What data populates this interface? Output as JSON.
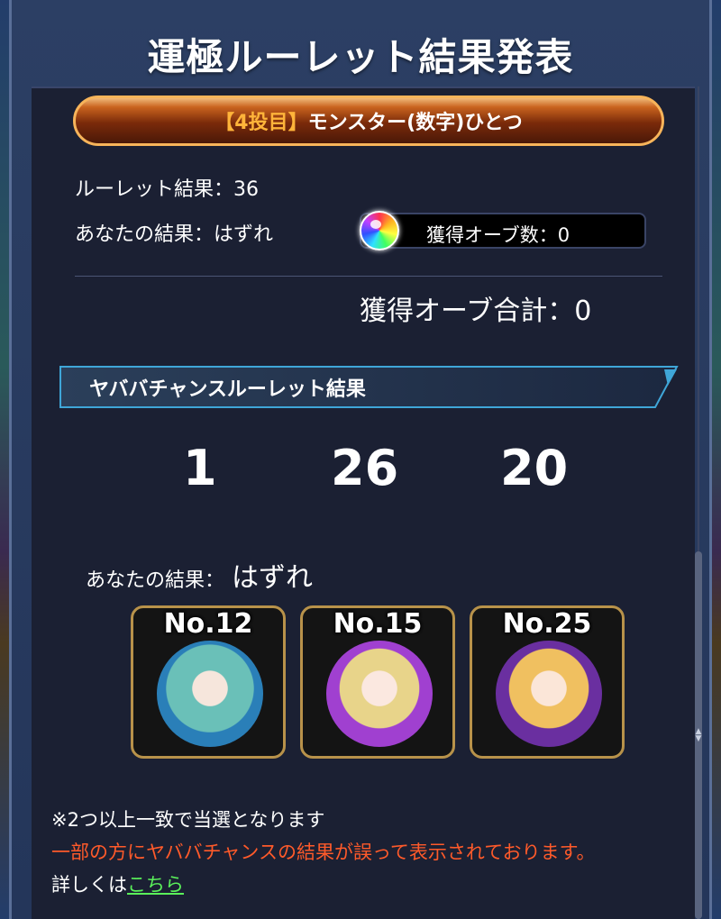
{
  "title": "運極ルーレット結果発表",
  "banner": {
    "tag": "【4投目】",
    "text": "モンスター(数字)ひとつ"
  },
  "roulette_result": "ルーレット結果：36",
  "your_result": "あなたの結果：はずれ",
  "orb_count": "獲得オーブ数：0",
  "orb_total": "獲得オーブ合計：0",
  "yababa": {
    "heading": "ヤババチャンスルーレット結果",
    "numbers": [
      "1",
      "26",
      "20"
    ],
    "your_result_label": "あなたの結果：",
    "your_result_value": "はずれ",
    "cards": [
      {
        "label": "No.12"
      },
      {
        "label": "No.15"
      },
      {
        "label": "No.25"
      }
    ]
  },
  "notes": {
    "rule": "※2つ以上一致で当選となります",
    "warning": "一部の方にヤババチャンスの結果が誤って表示されております。",
    "detail_prefix": "詳しくは",
    "detail_link": "こちら"
  },
  "colors": {
    "warning": "#ff5a2a",
    "link": "#5af05a",
    "banner_tag": "#ffb43a"
  }
}
